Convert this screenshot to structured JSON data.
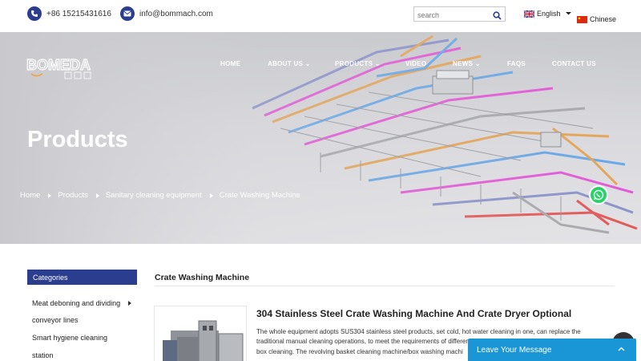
{
  "topbar": {
    "phone": "+86 15215431616",
    "email": "info@bommach.com",
    "search_placeholder": "search",
    "languages": [
      {
        "label": "English"
      },
      {
        "label": "Chinese"
      }
    ]
  },
  "header": {
    "logo_text": "BOMEDA",
    "nav": [
      {
        "label": "HOME"
      },
      {
        "label": "ABOUT US"
      },
      {
        "label": "PRODUCTS"
      },
      {
        "label": "VIDEO"
      },
      {
        "label": "NEWS"
      },
      {
        "label": "FAQS"
      },
      {
        "label": "CONTACT US"
      }
    ]
  },
  "banner": {
    "heading": "Products",
    "breadcrumb": [
      "Home",
      "Products",
      "Sanitary cleaning equipment",
      "Crate Washing Machine"
    ]
  },
  "sidebar": {
    "title": "Categories",
    "items": [
      {
        "line1": "Meat deboning and dividing",
        "line2": "conveyor lines"
      },
      {
        "line1": "Smart hygiene cleaning",
        "line2": "station"
      }
    ]
  },
  "main": {
    "section_title": "Crate Washing Machine",
    "product_title": "304 Stainless Steel Crate Washing Machine And Crate Dryer Optional",
    "desc_lines": [
      "The whole equipment adopts SUS304 stainless steel products, set cold, hot water cleaning in one, can replace the",
      "traditional manual cleaning operations, to meet the requirements of differen",
      "box cleaning. The revolving basket cleaning machine/box washing machi"
    ]
  },
  "chat": {
    "label": "Leave Your Message"
  },
  "colors": {
    "brand": "#2b3d8f",
    "chat": "#1a95d6",
    "whatsapp": "#25d366"
  }
}
